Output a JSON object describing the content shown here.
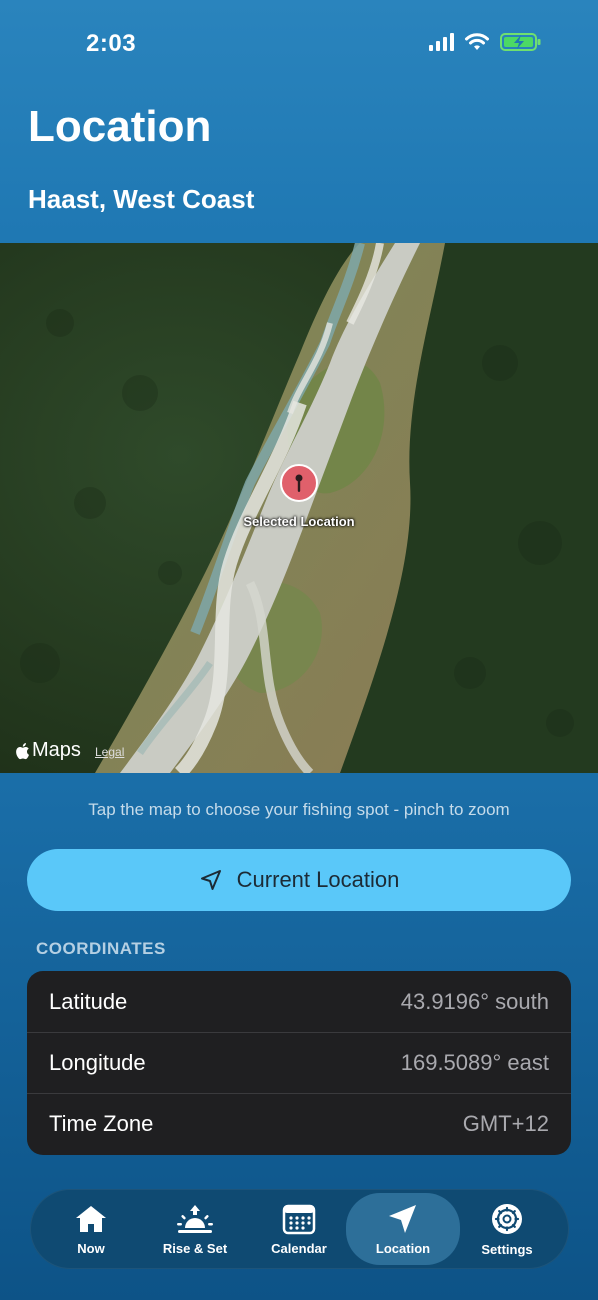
{
  "status_bar": {
    "time": "2:03"
  },
  "header": {
    "title": "Location",
    "subtitle": "Haast, West Coast"
  },
  "map": {
    "pin_label": "Selected Location",
    "brand": "Maps",
    "legal": "Legal"
  },
  "hint": "Tap the map to choose your fishing spot - pinch to zoom",
  "current_location_button": {
    "label": "Current Location",
    "icon": "location-arrow-icon"
  },
  "coordinates": {
    "section_title": "COORDINATES",
    "rows": [
      {
        "key": "Latitude",
        "value": "43.9196° south"
      },
      {
        "key": "Longitude",
        "value": "169.5089° east"
      },
      {
        "key": "Time Zone",
        "value": "GMT+12"
      }
    ]
  },
  "tab_bar": {
    "tabs": [
      {
        "label": "Now",
        "icon": "house-icon"
      },
      {
        "label": "Rise & Set",
        "icon": "sunrise-icon"
      },
      {
        "label": "Calendar",
        "icon": "calendar-icon"
      },
      {
        "label": "Location",
        "icon": "location-arrow-icon",
        "active": true
      },
      {
        "label": "Settings",
        "icon": "gear-icon"
      }
    ]
  },
  "colors": {
    "accent": "#5ac8f9",
    "card": "#1f1f21",
    "pin": "#e0606b"
  }
}
